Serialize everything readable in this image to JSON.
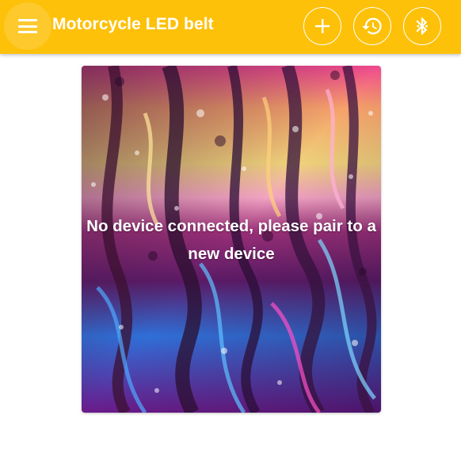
{
  "app_bar": {
    "title": "Motorcycle LED belt",
    "background_color": "#fdc10a",
    "menu_icon": "menu-icon",
    "actions": [
      {
        "icon": "add-icon"
      },
      {
        "icon": "history-icon"
      },
      {
        "icon": "bluetooth-icon"
      }
    ]
  },
  "main": {
    "status_message": "No device connected, please pair to a new device",
    "background_image": "colorful-paint-drops-image"
  }
}
